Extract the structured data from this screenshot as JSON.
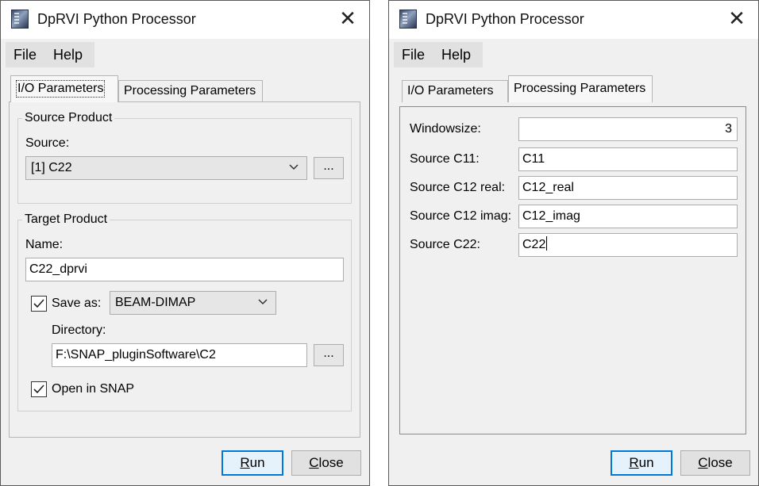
{
  "left_window": {
    "title": "DpRVI Python Processor",
    "menu": {
      "file": "File",
      "help": "Help"
    },
    "tabs": {
      "io": "I/O Parameters",
      "processing": "Processing Parameters"
    },
    "source_product": {
      "group_title": "Source Product",
      "source_label": "Source:",
      "source_value": "[1] C22",
      "browse_label": "..."
    },
    "target_product": {
      "group_title": "Target Product",
      "name_label": "Name:",
      "name_value": "C22_dprvi",
      "save_as_label": "Save as:",
      "save_as_checked": true,
      "format_value": "BEAM-DIMAP",
      "directory_label": "Directory:",
      "directory_value": "F:\\SNAP_pluginSoftware\\C2",
      "browse_label": "...",
      "open_in_snap_label": "Open in SNAP",
      "open_in_snap_checked": true
    },
    "buttons": {
      "run_mnemonic": "R",
      "run_rest": "un",
      "close_mnemonic": "C",
      "close_rest": "lose"
    }
  },
  "right_window": {
    "title": "DpRVI Python Processor",
    "menu": {
      "file": "File",
      "help": "Help"
    },
    "tabs": {
      "io": "I/O Parameters",
      "processing": "Processing Parameters"
    },
    "params": [
      {
        "label": "Windowsize:",
        "value": "3"
      },
      {
        "label": "Source C11:",
        "value": "C11"
      },
      {
        "label": "Source C12 real:",
        "value": "C12_real"
      },
      {
        "label": "Source C12 imag:",
        "value": "C12_imag"
      },
      {
        "label": "Source C22:",
        "value": "C22"
      }
    ],
    "buttons": {
      "run_mnemonic": "R",
      "run_rest": "un",
      "close_mnemonic": "C",
      "close_rest": "lose"
    }
  },
  "colors": {
    "dialog_bg": "#f0f0f0",
    "default_button_border": "#0078d7"
  },
  "icons": [
    "snap-app-icon",
    "close-icon",
    "chevron-down-icon",
    "checkmark-icon"
  ]
}
